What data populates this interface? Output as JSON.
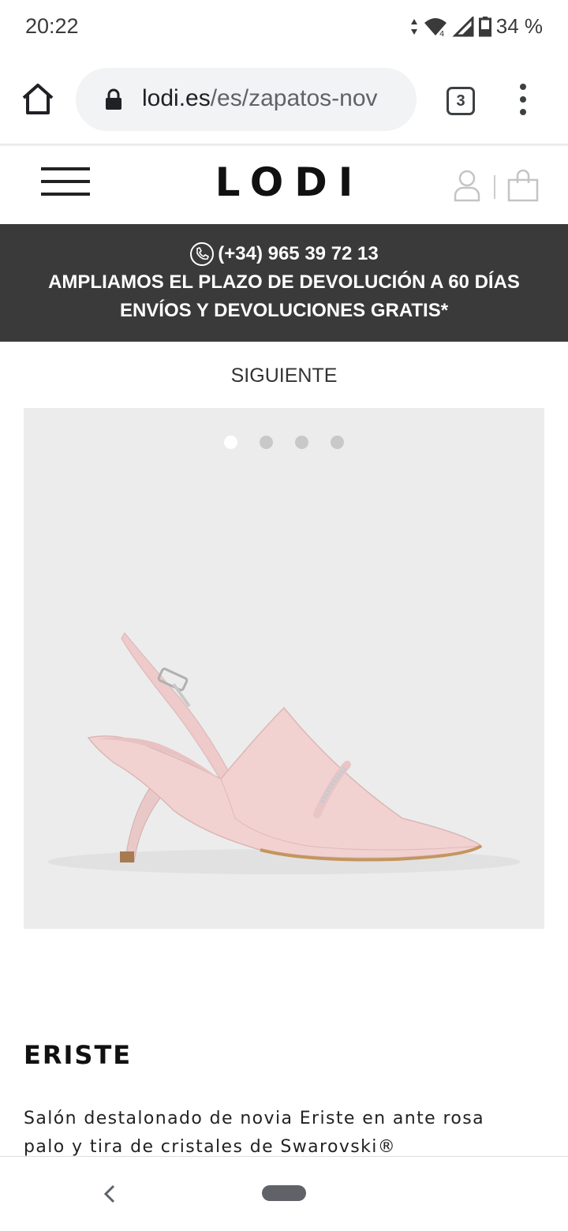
{
  "status_bar": {
    "time": "20:22",
    "battery": "34 %",
    "signal_badge": "4"
  },
  "browser": {
    "url_domain": "lodi.es",
    "url_path": "/es/zapatos-nov",
    "tab_count": "3"
  },
  "site": {
    "logo": "LODI"
  },
  "promo": {
    "phone": "(+34) 965 39 72 13",
    "line1": "AMPLIAMOS EL PLAZO DE DEVOLUCIÓN A 60 DÍAS",
    "line2": "ENVÍOS Y DEVOLUCIONES GRATIS*"
  },
  "nav": {
    "next_label": "SIGUIENTE"
  },
  "gallery": {
    "dots": 4,
    "active_index": 0
  },
  "product": {
    "name": "ERISTE",
    "description": "Salón destalonado de novia Eriste en ante rosa palo y tira de cristales de Swarovski®"
  }
}
